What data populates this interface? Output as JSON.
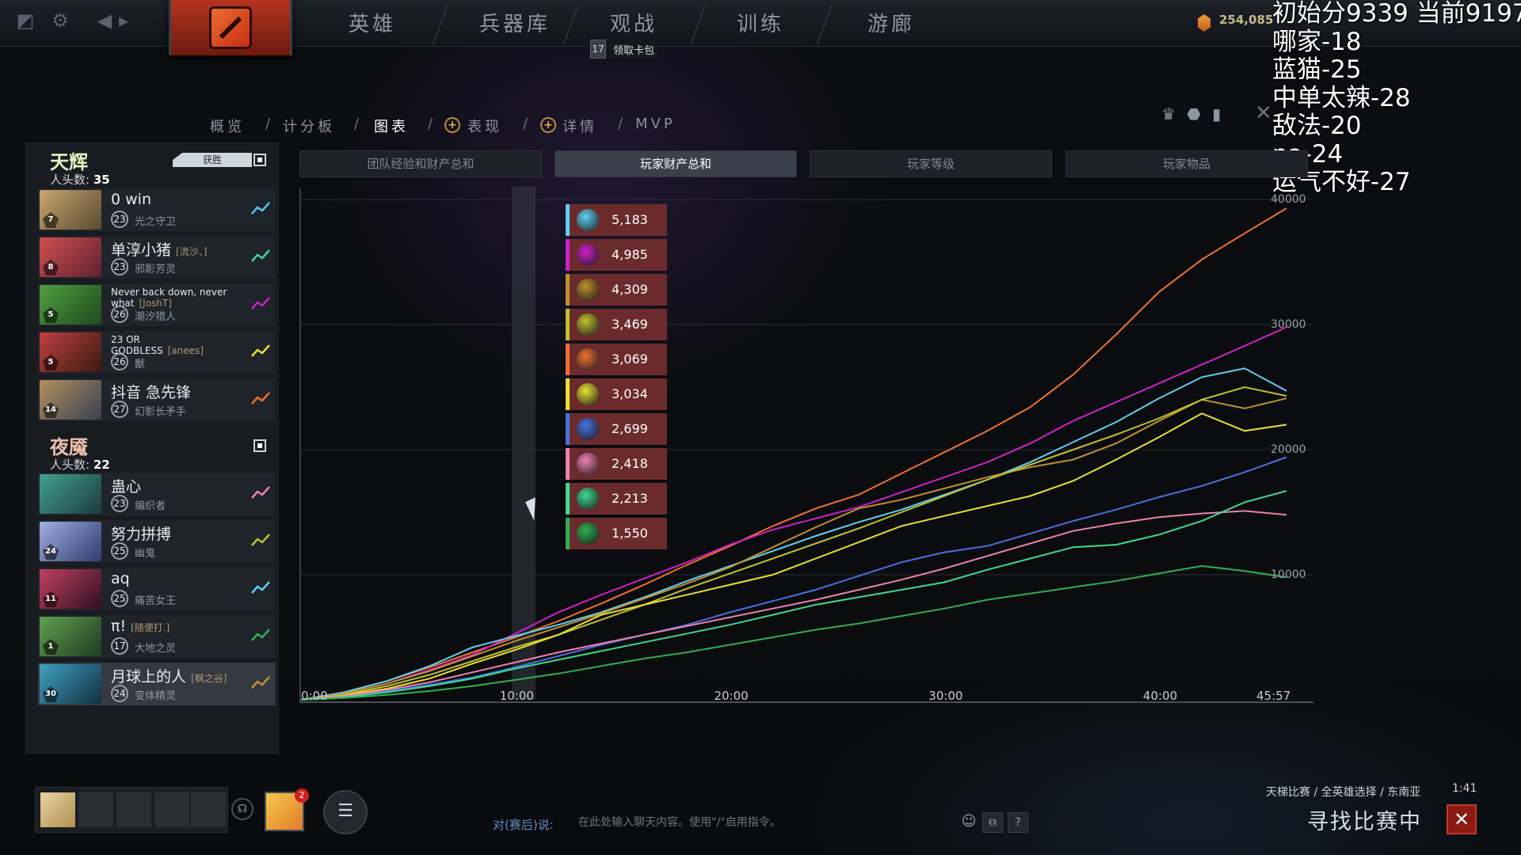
{
  "topbar": {
    "nav": [
      "英雄",
      "兵器库",
      "观战",
      "训练",
      "游廊"
    ],
    "card_badge": "17",
    "card_text": "领取卡包",
    "shards": "254,085"
  },
  "overlay_lines": [
    "初始分9339 当前9197",
    "哪家-18",
    "蓝猫-25",
    "中单太辣-28",
    "敌法-20",
    "pa-24",
    "运气不好-27"
  ],
  "subnav": {
    "items": [
      "概览",
      "计分板",
      "图表",
      "表现",
      "详情",
      "MVP"
    ],
    "active": "图表"
  },
  "radiant": {
    "name": "天辉",
    "kills_label": "人头数:",
    "kills": "35",
    "result": "获胜",
    "players": [
      {
        "name": "0 win",
        "tag": "",
        "level": "23",
        "hero": "光之守卫",
        "color": "#4fc8f0",
        "portrait": [
          "#c9a870",
          "#5a4a30"
        ],
        "badge": "7"
      },
      {
        "name": "单淳小猪",
        "tag": "[流沙、]",
        "level": "23",
        "hero": "邪影芳灵",
        "color": "#40d890",
        "portrait": [
          "#d05050",
          "#602030"
        ],
        "badge": "8"
      },
      {
        "name": "Never back down, never what",
        "tag": "[JoshT]",
        "level": "26",
        "hero": "潮汐猎人",
        "color": "#d020c8",
        "portrait": [
          "#50a040",
          "#1e4a20"
        ],
        "badge": "5"
      },
      {
        "name": "23 OR GODBLESS",
        "tag": "[anees]",
        "level": "26",
        "hero": "獸",
        "color": "#e8e030",
        "portrait": [
          "#c04040",
          "#3a1a10"
        ],
        "badge": "5"
      },
      {
        "name": "抖音 急先锋",
        "tag": "",
        "level": "27",
        "hero": "幻影长矛手",
        "color": "#f07030",
        "portrait": [
          "#b09060",
          "#3a4050"
        ],
        "badge": "14"
      }
    ]
  },
  "dire": {
    "name": "夜魇",
    "kills_label": "人头数:",
    "kills": "22",
    "players": [
      {
        "name": "蛊心",
        "tag": "",
        "level": "23",
        "hero": "编织者",
        "color": "#f080b0",
        "portrait": [
          "#40a090",
          "#1e3a40"
        ],
        "badge": ""
      },
      {
        "name": "努力拼搏",
        "tag": "",
        "level": "25",
        "hero": "幽鬼",
        "color": "#c0c030",
        "portrait": [
          "#a0b0e0",
          "#303a70"
        ],
        "badge": "24"
      },
      {
        "name": "aq",
        "tag": "",
        "level": "25",
        "hero": "痛苦女王",
        "color": "#60d0f0",
        "portrait": [
          "#c04060",
          "#301020"
        ],
        "badge": "11"
      },
      {
        "name": "π!",
        "tag": "[随便打.]",
        "level": "17",
        "hero": "大地之灵",
        "color": "#30b050",
        "portrait": [
          "#60a050",
          "#203a20"
        ],
        "badge": "1"
      },
      {
        "name": "月球上的人",
        "tag": "[枫之谷]",
        "level": "24",
        "hero": "变体精灵",
        "color": "#c09030",
        "portrait": [
          "#40a0c0",
          "#103040"
        ],
        "badge": "30"
      }
    ]
  },
  "chart_tabs": [
    "团队经验和财产总和",
    "玩家财产总和",
    "玩家等级",
    "玩家物品"
  ],
  "chart_tabs_active": 1,
  "chart_data": {
    "type": "line",
    "title": "玩家财产总和",
    "x": [
      0,
      2,
      4,
      6,
      8,
      10,
      12,
      14,
      16,
      18,
      20,
      22,
      24,
      26,
      28,
      30,
      32,
      34,
      36,
      38,
      40,
      42,
      44,
      45.95
    ],
    "x_ticks": [
      "0:00",
      "10:00",
      "20:00",
      "30:00",
      "40:00",
      "45:57"
    ],
    "x_tick_values": [
      0,
      10,
      20,
      30,
      40,
      45.95
    ],
    "y_ticks": [
      "10000",
      "20000",
      "30000",
      "40000"
    ],
    "ylim": [
      0,
      40000
    ],
    "series": [
      {
        "color": "#f07030",
        "values": [
          0,
          600,
          1500,
          2600,
          3800,
          5000,
          6300,
          7700,
          9200,
          10800,
          12300,
          13900,
          15300,
          16400,
          18100,
          19800,
          21500,
          23400,
          26000,
          29200,
          32600,
          35200,
          37300,
          39300
        ]
      },
      {
        "color": "#d020c8",
        "values": [
          0,
          500,
          1300,
          2400,
          3600,
          5300,
          7000,
          8400,
          9700,
          11000,
          12400,
          13600,
          14500,
          15400,
          16600,
          17800,
          19000,
          20500,
          22300,
          23800,
          25300,
          26800,
          28300,
          29800
        ]
      },
      {
        "color": "#60d0f0",
        "values": [
          0,
          600,
          1500,
          2700,
          4200,
          5100,
          6000,
          7000,
          8200,
          9500,
          10700,
          11900,
          13100,
          14200,
          15200,
          16400,
          17600,
          19000,
          20600,
          22200,
          24100,
          25800,
          26500,
          24700
        ]
      },
      {
        "color": "#c09030",
        "values": [
          0,
          500,
          1300,
          2300,
          3500,
          4700,
          5800,
          6900,
          8100,
          9300,
          10600,
          12200,
          13800,
          15300,
          16000,
          16900,
          17800,
          18600,
          19200,
          20500,
          22300,
          24000,
          23300,
          24100
        ]
      },
      {
        "color": "#c0c030",
        "values": [
          0,
          400,
          1100,
          2000,
          3100,
          4200,
          5200,
          6400,
          7600,
          8900,
          10100,
          11300,
          12500,
          13700,
          15000,
          16300,
          17600,
          18800,
          20000,
          21200,
          22500,
          24000,
          25000,
          24300
        ]
      },
      {
        "color": "#e8e030",
        "values": [
          0,
          350,
          900,
          1700,
          2900,
          4000,
          5200,
          6800,
          7600,
          8400,
          9200,
          10000,
          11300,
          12600,
          13900,
          14700,
          15500,
          16300,
          17500,
          19200,
          21000,
          22900,
          21500,
          22000
        ]
      },
      {
        "color": "#4a70e0",
        "values": [
          0,
          300,
          700,
          1200,
          1800,
          2600,
          3500,
          4400,
          5200,
          6000,
          7000,
          7900,
          8800,
          9900,
          11000,
          11800,
          12300,
          13300,
          14300,
          15200,
          16200,
          17100,
          18200,
          19400
        ]
      },
      {
        "color": "#f080b0",
        "values": [
          0,
          300,
          800,
          1400,
          2200,
          3000,
          3800,
          4500,
          5200,
          5900,
          6600,
          7300,
          8000,
          8800,
          9600,
          10500,
          11500,
          12500,
          13500,
          14100,
          14600,
          14900,
          15100,
          14800
        ]
      },
      {
        "color": "#40d890",
        "values": [
          0,
          200,
          600,
          1100,
          1700,
          2500,
          3200,
          3900,
          4600,
          5300,
          6000,
          6800,
          7600,
          8200,
          8800,
          9400,
          10400,
          11300,
          12200,
          12400,
          13200,
          14300,
          15800,
          16700
        ]
      },
      {
        "color": "#30b050",
        "values": [
          0,
          150,
          400,
          700,
          1100,
          1600,
          2100,
          2700,
          3300,
          3800,
          4400,
          5000,
          5600,
          6100,
          6700,
          7300,
          8000,
          8500,
          9000,
          9500,
          10100,
          10700,
          10300,
          9800
        ]
      }
    ],
    "tooltip": [
      {
        "value": "5,183",
        "color": "#60d0f0"
      },
      {
        "value": "4,985",
        "color": "#d020c8"
      },
      {
        "value": "4,309",
        "color": "#c09030"
      },
      {
        "value": "3,469",
        "color": "#c0c030"
      },
      {
        "value": "3,069",
        "color": "#f07030"
      },
      {
        "value": "3,034",
        "color": "#e8e030"
      },
      {
        "value": "2,699",
        "color": "#4a70e0"
      },
      {
        "value": "2,418",
        "color": "#f080b0"
      },
      {
        "value": "2,213",
        "color": "#40d890"
      },
      {
        "value": "1,550",
        "color": "#30b050"
      }
    ]
  },
  "chat": {
    "label": "对(赛后)说:",
    "placeholder": "在此处输入聊天内容。使用\"/\"启用指令。"
  },
  "matchmaking": {
    "mode": "天梯比赛 / 全英雄选择 / 东南亚",
    "time": "1:41",
    "status": "寻找比赛中",
    "cancel": "✕"
  },
  "party": {
    "notifications": "2"
  }
}
